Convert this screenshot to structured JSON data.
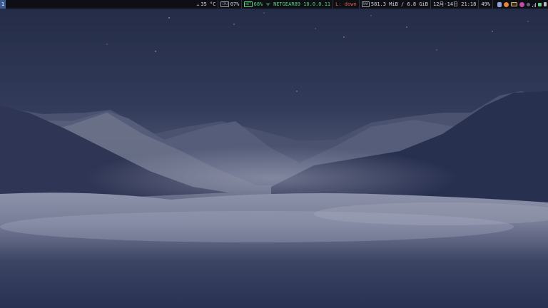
{
  "workspace": {
    "label": "1"
  },
  "status_bar": {
    "temperature": "35 °C",
    "cpu_chip": "CPU",
    "cpu_usage": "07%",
    "wifi_chip": "NET",
    "wifi": "68% ᯤ NETGEAR89 10.0.0.11",
    "network_down": "L: down",
    "mem_chip": "RAM",
    "memory": "581.3 MiB / 6.8 GiB",
    "datetime": "12月-14日 21:18",
    "battery": "49%"
  },
  "tray_icons": [
    "clipboard-icon",
    "firefox-icon",
    "keyboard-icon",
    "app-icon",
    "volume-icon",
    "signal-icon",
    "nm-applet-icon",
    "power-icon"
  ],
  "colors": {
    "bar_bg": "#0d0f15",
    "text": "#d8dbe2",
    "green": "#5fcf80",
    "red": "#e05a4a",
    "workspace_active": "#3b5b8f"
  }
}
